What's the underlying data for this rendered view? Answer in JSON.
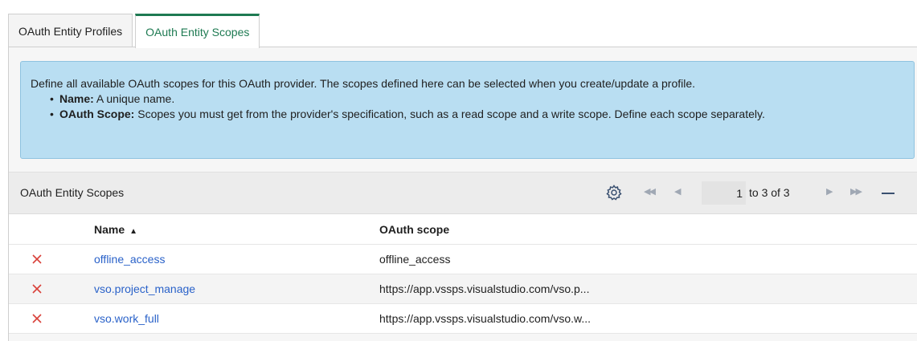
{
  "tabs": [
    {
      "label": "OAuth Entity Profiles",
      "active": false
    },
    {
      "label": "OAuth Entity Scopes",
      "active": true
    }
  ],
  "info": {
    "intro": "Define all available OAuth scopes for this OAuth provider. The scopes defined here can be selected when you create/update a profile.",
    "items": [
      {
        "term": "Name:",
        "text": " A unique name."
      },
      {
        "term": "OAuth Scope:",
        "text": " Scopes you must get from the provider's specification, such as a read scope and a write scope. Define each scope separately."
      }
    ]
  },
  "list": {
    "title": "OAuth Entity Scopes",
    "icons": {
      "settings": "gear-icon",
      "first": "double-chevron-left-icon",
      "prev": "chevron-left-icon",
      "next": "chevron-right-icon",
      "last": "double-chevron-right-icon",
      "collapse": "minus-icon"
    },
    "pagination": {
      "current": "1",
      "range": "to 3 of 3"
    },
    "columns": {
      "name": "Name",
      "scope": "OAuth scope",
      "sort": "▲"
    },
    "rows": [
      {
        "name": "offline_access",
        "scope": "offline_access"
      },
      {
        "name": "vso.project_manage",
        "scope": "https://app.vssps.visualstudio.com/vso.p..."
      },
      {
        "name": "vso.work_full",
        "scope": "https://app.vssps.visualstudio.com/vso.w..."
      }
    ]
  },
  "colors": {
    "accent": "#1e7a52",
    "link": "#2a62c9",
    "delete": "#d9413a",
    "info_bg": "#b9def2"
  }
}
